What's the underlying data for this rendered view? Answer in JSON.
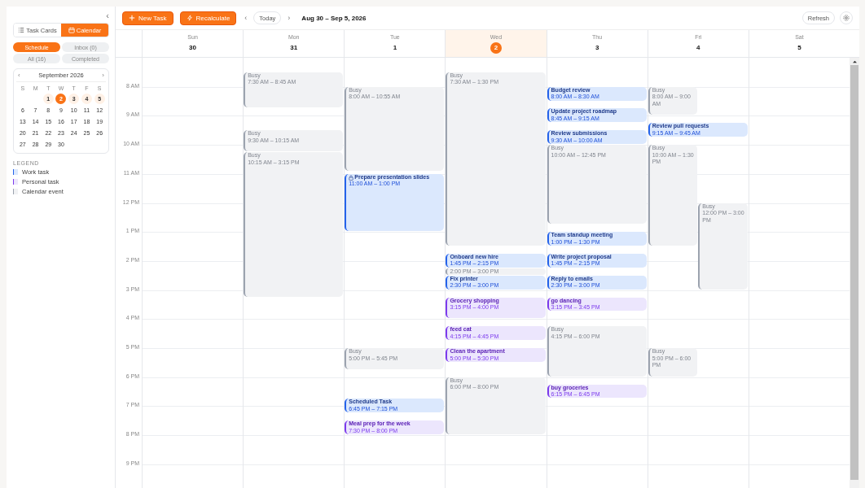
{
  "sidebar": {
    "collapse_glyph": "‹",
    "view_toggle": [
      {
        "label": "Task Cards",
        "kind": "list",
        "selected": false
      },
      {
        "label": "Calendar",
        "kind": "calendar",
        "selected": true
      }
    ],
    "filters": [
      {
        "label": "Schedule",
        "selected": true
      },
      {
        "label": "Inbox (0)",
        "selected": false
      },
      {
        "label": "All (16)",
        "selected": false
      },
      {
        "label": "Completed",
        "selected": false
      }
    ],
    "mini_calendar": {
      "prev": "‹",
      "title": "September 2026",
      "next": "›",
      "weekdays": [
        "S",
        "M",
        "T",
        "W",
        "T",
        "F",
        "S"
      ],
      "weeks": [
        [
          {
            "day": "1",
            "in_week": true,
            "selected": false
          },
          {
            "day": "2",
            "in_week": true,
            "selected": true
          },
          {
            "day": "3",
            "in_week": true,
            "selected": false
          },
          {
            "day": "4",
            "in_week": true,
            "selected": false
          },
          {
            "day": "5",
            "in_week": true,
            "selected": false
          }
        ],
        [
          {
            "day": "6",
            "in_week": false,
            "selected": false
          },
          {
            "day": "7",
            "in_week": false,
            "selected": false
          },
          {
            "day": "8",
            "in_week": false,
            "selected": false
          },
          {
            "day": "9",
            "in_week": false,
            "selected": false
          },
          {
            "day": "10",
            "in_week": false,
            "selected": false
          },
          {
            "day": "11",
            "in_week": false,
            "selected": false
          },
          {
            "day": "12",
            "in_week": false,
            "selected": false
          }
        ],
        [
          {
            "day": "13",
            "in_week": false,
            "selected": false
          },
          {
            "day": "14",
            "in_week": false,
            "selected": false
          },
          {
            "day": "15",
            "in_week": false,
            "selected": false
          },
          {
            "day": "16",
            "in_week": false,
            "selected": false
          },
          {
            "day": "17",
            "in_week": false,
            "selected": false
          },
          {
            "day": "18",
            "in_week": false,
            "selected": false
          },
          {
            "day": "19",
            "in_week": false,
            "selected": false
          }
        ],
        [
          {
            "day": "20",
            "in_week": false,
            "selected": false
          },
          {
            "day": "21",
            "in_week": false,
            "selected": false
          },
          {
            "day": "22",
            "in_week": false,
            "selected": false
          },
          {
            "day": "23",
            "in_week": false,
            "selected": false
          },
          {
            "day": "24",
            "in_week": false,
            "selected": false
          },
          {
            "day": "25",
            "in_week": false,
            "selected": false
          },
          {
            "day": "26",
            "in_week": false,
            "selected": false
          }
        ],
        [
          {
            "day": "27",
            "in_week": false,
            "selected": false
          },
          {
            "day": "28",
            "in_week": false,
            "selected": false
          },
          {
            "day": "29",
            "in_week": false,
            "selected": false
          },
          {
            "day": "30",
            "in_week": false,
            "selected": false
          }
        ]
      ]
    },
    "legend": {
      "title": "LEGEND",
      "items": [
        {
          "label": "Work task",
          "kind": "work"
        },
        {
          "label": "Personal task",
          "kind": "personal"
        },
        {
          "label": "Calendar event",
          "kind": "busy"
        }
      ]
    }
  },
  "toolbar": {
    "new_task": "New Task",
    "recalculate": "Recalculate",
    "prev": "‹",
    "today": "Today",
    "next": "›",
    "range": "Aug 30 – Sep 5, 2026",
    "refresh": "Refresh"
  },
  "hour_labels": [
    "8 AM",
    "9 AM",
    "10 AM",
    "11 AM",
    "12 PM",
    "1 PM",
    "2 PM",
    "3 PM",
    "4 PM",
    "5 PM",
    "6 PM",
    "7 PM",
    "8 PM",
    "9 PM"
  ],
  "days": [
    {
      "name": "Sun",
      "date": "30",
      "selected": false
    },
    {
      "name": "Mon",
      "date": "31",
      "selected": false,
      "events": [
        {
          "kind": "busy",
          "title": "Busy",
          "time": "7:30 AM – 8:45 AM"
        },
        {
          "kind": "busy",
          "title": "Busy",
          "time": "9:30 AM – 10:15 AM"
        },
        {
          "kind": "busy",
          "title": "Busy",
          "time": "10:15 AM – 3:15 PM"
        }
      ]
    },
    {
      "name": "Tue",
      "date": "1",
      "selected": false,
      "events": [
        {
          "kind": "busy",
          "title": "Busy",
          "time": "8:00 AM – 10:55 AM"
        },
        {
          "kind": "work",
          "title": "Prepare presentation slides",
          "time": "11:00 AM – 1:00 PM",
          "locked": true
        },
        {
          "kind": "busy",
          "title": "Busy",
          "time": "5:00 PM – 5:45 PM"
        },
        {
          "kind": "work",
          "title": "Scheduled Task",
          "time": "6:45 PM – 7:15 PM"
        },
        {
          "kind": "personal",
          "title": "Meal prep for the week",
          "time": "7:30 PM – 8:00 PM"
        }
      ]
    },
    {
      "name": "Wed",
      "date": "2",
      "selected": true,
      "events": [
        {
          "kind": "busy",
          "title": "Busy",
          "time": "7:30 AM – 1:30 PM"
        },
        {
          "kind": "work",
          "title": "Onboard new hire",
          "time": "1:45 PM – 2:15 PM"
        },
        {
          "kind": "busy",
          "time": "2:00 PM – 3:00 PM"
        },
        {
          "kind": "work",
          "title": "Fix printer",
          "time": "2:30 PM – 3:00 PM"
        },
        {
          "kind": "personal",
          "title": "Grocery shopping",
          "time": "3:15 PM – 4:00 PM"
        },
        {
          "kind": "personal",
          "title": "feed cat",
          "time": "4:15 PM – 4:45 PM"
        },
        {
          "kind": "personal",
          "title": "Clean the apartment",
          "time": "5:00 PM – 5:30 PM"
        },
        {
          "kind": "busy",
          "title": "Busy",
          "time": "6:00 PM – 8:00 PM"
        }
      ]
    },
    {
      "name": "Thu",
      "date": "3",
      "selected": false,
      "events": [
        {
          "kind": "work",
          "title": "Budget review",
          "time": "8:00 AM – 8:30 AM"
        },
        {
          "kind": "work",
          "title": "Update project roadmap",
          "time": "8:45 AM – 9:15 AM"
        },
        {
          "kind": "work",
          "title": "Review submissions",
          "time": "9:30 AM – 10:00 AM"
        },
        {
          "kind": "busy",
          "title": "Busy",
          "time": "10:00 AM – 12:45 PM"
        },
        {
          "kind": "work",
          "title": "Team standup meeting",
          "time": "1:00 PM – 1:30 PM"
        },
        {
          "kind": "work",
          "title": "Write project proposal",
          "time": "1:45 PM – 2:15 PM"
        },
        {
          "kind": "work",
          "title": "Reply to emails",
          "time": "2:30 PM – 3:00 PM"
        },
        {
          "kind": "personal",
          "title": "go dancing",
          "time": "3:15 PM – 3:45 PM"
        },
        {
          "kind": "busy",
          "title": "Busy",
          "time": "4:15 PM – 6:00 PM"
        },
        {
          "kind": "personal",
          "title": "buy groceries",
          "time": "6:15 PM – 6:45 PM"
        }
      ]
    },
    {
      "name": "Fri",
      "date": "4",
      "selected": false,
      "events": [
        {
          "kind": "busy",
          "title": "Busy",
          "time": "8:00 AM – 9:00 AM"
        },
        {
          "kind": "work",
          "title": "Review pull requests",
          "time": "9:15 AM – 9:45 AM"
        },
        {
          "kind": "busy",
          "title": "Busy",
          "time": "10:00 AM – 1:30 PM"
        },
        {
          "kind": "busy",
          "title": "Busy",
          "time": "12:00 PM – 3:00 PM"
        },
        {
          "kind": "busy",
          "title": "Busy",
          "time": "5:00 PM – 6:00 PM"
        }
      ]
    },
    {
      "name": "Sat",
      "date": "5",
      "selected": false
    }
  ]
}
